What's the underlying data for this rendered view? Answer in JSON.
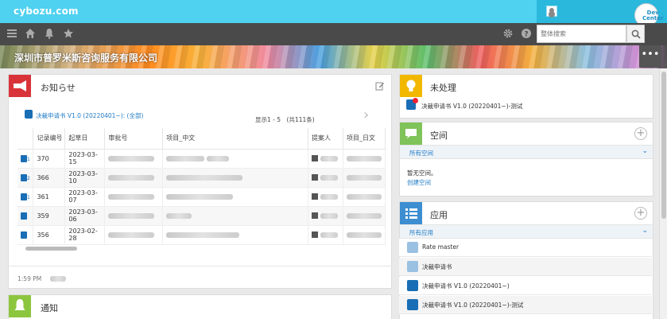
{
  "header": {
    "logo": "cybozu.com",
    "badge_text": "Dev Center",
    "search_placeholder": "整体搜索",
    "icons": [
      "menu-icon",
      "home-icon",
      "bell-icon",
      "star-icon",
      "gear-icon",
      "help-icon",
      "search-icon"
    ]
  },
  "banner": {
    "title": "深圳市普罗米斯咨询服务有限公司",
    "more": "•••"
  },
  "notice": {
    "title": "お知らせ",
    "app_link": "决裁申请书 V1.0 (20220401~): (全部)",
    "pager": "显示1 - 5　(共111条)",
    "next_arrow": "›",
    "columns": [
      "",
      "记录编号",
      "起草日",
      "审批号",
      "项目_中文",
      "提案人",
      "项目_日文"
    ],
    "rows": [
      {
        "sub": "1",
        "id": "370",
        "date": "2023-03-15"
      },
      {
        "sub": "2",
        "id": "366",
        "date": "2023-03-10"
      },
      {
        "sub": "1",
        "id": "361",
        "date": "2023-03-07"
      },
      {
        "sub": "",
        "id": "359",
        "date": "2023-03-06"
      },
      {
        "sub": "",
        "id": "356",
        "date": "2023-02-28"
      }
    ],
    "footer_time": "1:59 PM"
  },
  "notify": {
    "title": "通知"
  },
  "pending": {
    "title": "未处理",
    "item": "决裁申请书 V1.0 (20220401~)-测试"
  },
  "space": {
    "title": "空间",
    "filter": "所有空间",
    "empty": "暂无空间。",
    "create": "创建空间"
  },
  "apps": {
    "title": "应用",
    "filter": "所有应用",
    "items": [
      "Rate master",
      "决裁申请书",
      "决裁申请书 V1.0 (20220401~)",
      "决裁申请书 V1.0 (20220401~)-测试"
    ]
  },
  "colors": {
    "topbar": "#4fd1f0",
    "navbar": "#4a4a4a",
    "notice_icon": "#d9333a",
    "pending_icon": "#f2b800",
    "space_icon": "#7fc35a",
    "apps_icon": "#3d8ed1",
    "notify_icon": "#8cc63f",
    "link": "#1e7ac4"
  }
}
